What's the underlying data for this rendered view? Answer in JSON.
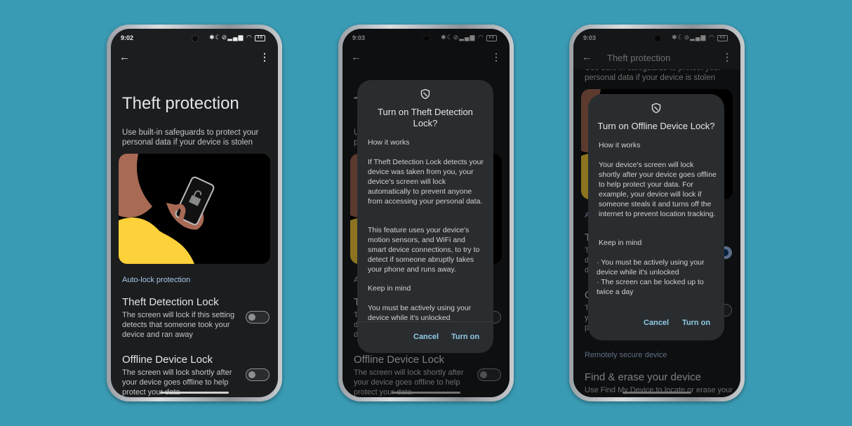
{
  "colors": {
    "background": "#3a9bb4",
    "screen": "#1b1d1f",
    "dialog": "#2a2d30",
    "accent": "#8ecbe6",
    "section": "#a8c7e8"
  },
  "screens": [
    {
      "time": "9:02",
      "battery": "46"
    },
    {
      "time": "9:03",
      "battery": "46"
    },
    {
      "time": "9:03",
      "battery": "46",
      "appbar_title": "Theft protection"
    }
  ],
  "icons": {
    "back": "arrow-left-icon",
    "more": "more-vert-icon",
    "dialog": "shield-icon",
    "status": [
      "bluetooth-icon",
      "moon-icon",
      "alarm-off-icon",
      "signal-icon",
      "wifi-icon",
      "battery-icon"
    ]
  },
  "settings": {
    "title": "Theft protection",
    "subtitle": "Use built-in safeguards to protect your personal data if your device is stolen",
    "section_autolock": "Auto-lock protection",
    "theft_detection": {
      "title": "Theft Detection Lock",
      "desc": "The screen will lock if this setting detects that someone took your device and ran away"
    },
    "offline_lock": {
      "title": "Offline Device Lock",
      "desc": "The screen will lock shortly after your device goes offline to help protect your data"
    },
    "section_remote": "Remotely secure device",
    "find_erase": {
      "title": "Find & erase your device",
      "desc": "Use Find My Device to locate or erase your"
    }
  },
  "toggles": {
    "screen1": {
      "theft_detection": false,
      "offline_lock": false
    },
    "screen2": {
      "theft_detection": false,
      "offline_lock": false
    },
    "screen3": {
      "theft_detection": true,
      "offline_lock": false
    }
  },
  "dialogs": {
    "theft_detection": {
      "title": "Turn on Theft Detection Lock?",
      "how": "How it works",
      "p1": "If Theft Detection Lock detects your device was taken from you, your device's screen will lock automatically to prevent anyone from accessing your personal data.",
      "p2": "This feature uses your device's motion sensors, and WiFi and smart device connections, to try to detect if someone abruptly takes your phone and runs away.",
      "keep": "Keep in mind",
      "p3": "You must be actively using your device while it's unlocked",
      "cancel": "Cancel",
      "confirm": "Turn on"
    },
    "offline": {
      "title": "Turn on Offline Device Lock?",
      "how": "How it works",
      "p1": "Your device's screen will lock shortly after your device goes offline to help protect your data. For example, your device will lock if someone steals it and turns off the internet to prevent location tracking.",
      "keep": "Keep in mind",
      "b1": "· You must be actively using your\n  device while it's unlocked",
      "b2": "· The screen can be locked up to\n  twice a day",
      "cancel": "Cancel",
      "confirm": "Turn on"
    }
  }
}
